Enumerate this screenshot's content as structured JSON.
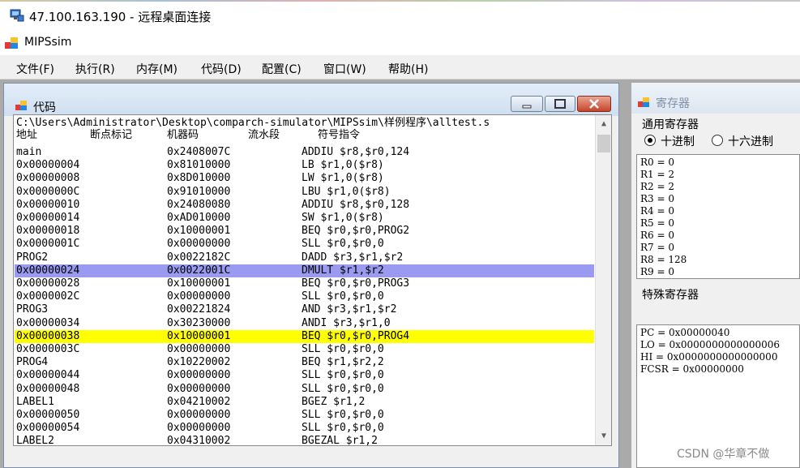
{
  "remote_desktop": {
    "title": "47.100.163.190 - 远程桌面连接"
  },
  "app": {
    "title": "MIPSsim"
  },
  "menu": [
    "文件(F)",
    "执行(R)",
    "内存(M)",
    "代码(D)",
    "配置(C)",
    "窗口(W)",
    "帮助(H)"
  ],
  "code_window": {
    "title": "代码",
    "path": "C:\\Users\\Administrator\\Desktop\\comparch-simulator\\MIPSsim\\样例程序\\alltest.s",
    "headers": {
      "addr": "地址",
      "bp": "断点标记",
      "machine": "机器码",
      "pipe": "流水段",
      "instr": "符号指令"
    },
    "rows": [
      {
        "addr": "main",
        "code": "0x2408007C",
        "instr": "ADDIU $r8,$r0,124",
        "hl": ""
      },
      {
        "addr": "0x00000004",
        "code": "0x81010000",
        "instr": "LB $r1,0($r8)",
        "hl": ""
      },
      {
        "addr": "0x00000008",
        "code": "0x8D010000",
        "instr": "LW $r1,0($r8)",
        "hl": ""
      },
      {
        "addr": "0x0000000C",
        "code": "0x91010000",
        "instr": "LBU $r1,0($r8)",
        "hl": ""
      },
      {
        "addr": "0x00000010",
        "code": "0x24080080",
        "instr": "ADDIU $r8,$r0,128",
        "hl": ""
      },
      {
        "addr": "0x00000014",
        "code": "0xAD010000",
        "instr": "SW $r1,0($r8)",
        "hl": ""
      },
      {
        "addr": "0x00000018",
        "code": "0x10000001",
        "instr": "BEQ $r0,$r0,PROG2",
        "hl": ""
      },
      {
        "addr": "0x0000001C",
        "code": "0x00000000",
        "instr": "SLL $r0,$r0,0",
        "hl": ""
      },
      {
        "addr": "PROG2",
        "code": "0x0022182C",
        "instr": "DADD $r3,$r1,$r2",
        "hl": ""
      },
      {
        "addr": "0x00000024",
        "code": "0x0022001C",
        "instr": "DMULT $r1,$r2",
        "hl": "#9a9af0"
      },
      {
        "addr": "0x00000028",
        "code": "0x10000001",
        "instr": "BEQ $r0,$r0,PROG3",
        "hl": ""
      },
      {
        "addr": "0x0000002C",
        "code": "0x00000000",
        "instr": "SLL $r0,$r0,0",
        "hl": ""
      },
      {
        "addr": "PROG3",
        "code": "0x00221824",
        "instr": "AND $r3,$r1,$r2",
        "hl": ""
      },
      {
        "addr": "0x00000034",
        "code": "0x30230000",
        "instr": "ANDI $r3,$r1,0",
        "hl": ""
      },
      {
        "addr": "0x00000038",
        "code": "0x10000001",
        "instr": "BEQ $r0,$r0,PROG4",
        "hl": "#ffff00"
      },
      {
        "addr": "0x0000003C",
        "code": "0x00000000",
        "instr": "SLL $r0,$r0,0",
        "hl": ""
      },
      {
        "addr": "PROG4",
        "code": "0x10220002",
        "instr": "BEQ $r1,$r2,2",
        "hl": ""
      },
      {
        "addr": "0x00000044",
        "code": "0x00000000",
        "instr": "SLL $r0,$r0,0",
        "hl": ""
      },
      {
        "addr": "0x00000048",
        "code": "0x00000000",
        "instr": "SLL $r0,$r0,0",
        "hl": ""
      },
      {
        "addr": "LABEL1",
        "code": "0x04210002",
        "instr": "BGEZ $r1,2",
        "hl": ""
      },
      {
        "addr": "0x00000050",
        "code": "0x00000000",
        "instr": "SLL $r0,$r0,0",
        "hl": ""
      },
      {
        "addr": "0x00000054",
        "code": "0x00000000",
        "instr": "SLL $r0,$r0,0",
        "hl": ""
      },
      {
        "addr": "LABEL2",
        "code": "0x04310002",
        "instr": "BGEZAL $r1,2",
        "hl": ""
      }
    ]
  },
  "register_window": {
    "title": "寄存器",
    "general_label": "通用寄存器",
    "radio_decimal": "十进制",
    "radio_hex": "十六进制",
    "general_regs": [
      "R0 = 0",
      "R1 = 2",
      "R2 = 2",
      "R3 = 0",
      "R4 = 0",
      "R5 = 0",
      "R6 = 0",
      "R7 = 0",
      "R8 = 128",
      "R9 = 0"
    ],
    "special_label": "特殊寄存器",
    "special_regs": [
      "PC = 0x00000040",
      "LO = 0x0000000000000006",
      "HI = 0x0000000000000000",
      "FCSR = 0x00000000"
    ]
  },
  "watermark": "CSDN @华章不做"
}
